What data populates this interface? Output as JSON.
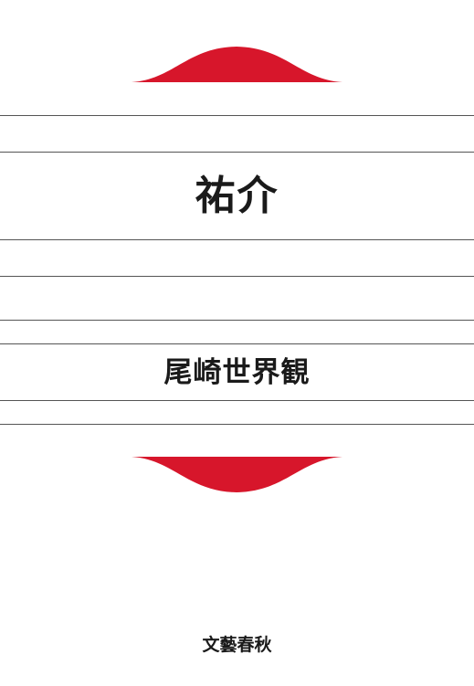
{
  "cover": {
    "title": "祐介",
    "author": "尾崎世界観",
    "publisher": "文藝春秋"
  },
  "colors": {
    "accent": "#d7162b",
    "rule": "#555555",
    "text": "#1a1a1a",
    "background": "#ffffff"
  }
}
